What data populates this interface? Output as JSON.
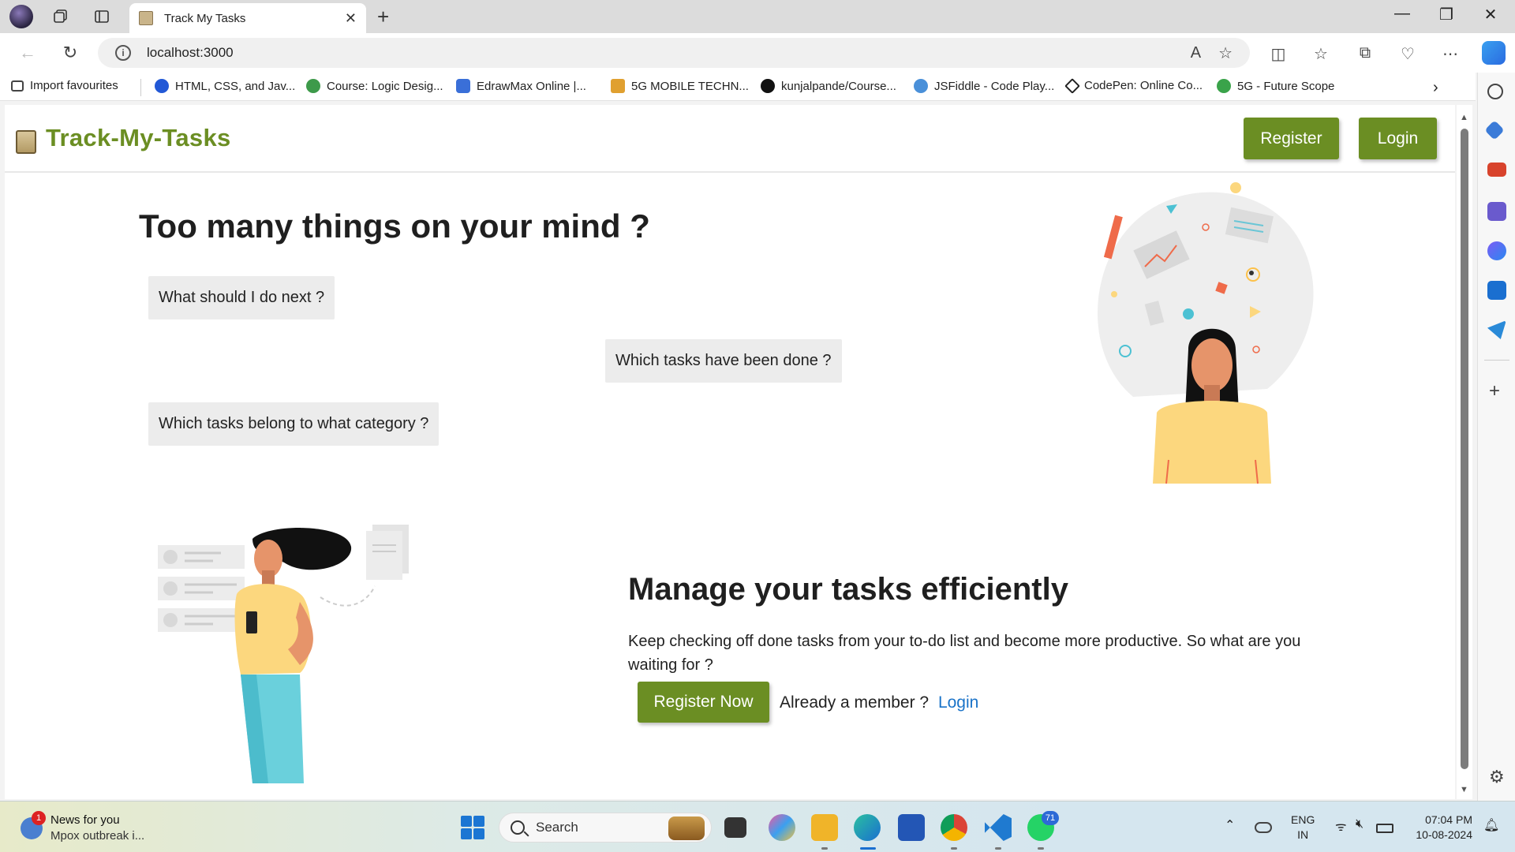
{
  "browser": {
    "tab_title": "Track My Tasks",
    "tab_close": "✕",
    "new_tab": "+",
    "url": "localhost:3000",
    "bookmarks": [
      {
        "label": "Import favourites",
        "color": "#444444"
      },
      {
        "label": "HTML, CSS, and Jav...",
        "color": "#2258d6"
      },
      {
        "label": "Course: Logic Desig...",
        "color": "#3d9a4a"
      },
      {
        "label": "EdrawMax Online |...",
        "color": "#3a6fd8"
      },
      {
        "label": "5G MOBILE TECHN...",
        "color": "#e0a030"
      },
      {
        "label": "kunjalpande/Course...",
        "color": "#111111"
      },
      {
        "label": "JSFiddle - Code Play...",
        "color": "#4a90d9"
      },
      {
        "label": "CodePen: Online Co...",
        "color": "#222222"
      },
      {
        "label": "5G - Future Scope",
        "color": "#3aa34a"
      }
    ],
    "window_controls": [
      "—",
      "❐",
      "✕"
    ]
  },
  "app": {
    "brand": "Track-My-Tasks",
    "nav_register": "Register",
    "nav_login": "Login",
    "hero_title": "Too many things on your mind ?",
    "questions": [
      "What should I do next ?",
      "Which tasks have been done ?",
      "Which tasks belong to what category ?"
    ],
    "section_title": "Manage your tasks efficiently",
    "section_desc": "Keep checking off done tasks from your to-do list and become more productive. So what are you waiting for ?",
    "register_now": "Register Now",
    "member_text": "Already a member ?",
    "member_login": "Login",
    "accent": "#6b8e23",
    "link_color": "#1a73c8"
  },
  "taskbar": {
    "news_title": "News for you",
    "news_sub": "Mpox outbreak i...",
    "news_badge": "1",
    "search_placeholder": "Search",
    "whatsapp_badge": "71",
    "lang_line1": "ENG",
    "lang_line2": "IN",
    "time": "07:04 PM",
    "date": "10-08-2024"
  }
}
